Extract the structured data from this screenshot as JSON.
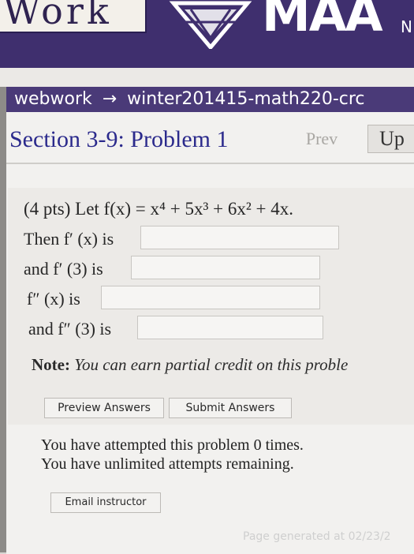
{
  "header": {
    "logo_text": "Work",
    "maa_text": "MAA",
    "maa_extra": "N"
  },
  "breadcrumb": {
    "root": "webwork",
    "arrow": "→",
    "course": "winter201415-math220-crc"
  },
  "section": {
    "title": "Section 3-9: Problem 1",
    "prev_label": "Prev",
    "up_label": "Up"
  },
  "problem": {
    "intro": "(4 pts) Let f(x) = x⁴ + 5x³ + 6x² + 4x.",
    "line1": "Then f′ (x) is",
    "line2": "and f′ (3) is",
    "line3": "f″ (x) is",
    "line4": "and f″ (3) is",
    "answers": [
      "",
      "",
      "",
      ""
    ]
  },
  "note": {
    "label": "Note:",
    "text": "You can earn partial credit on this proble"
  },
  "buttons": {
    "preview": "Preview Answers",
    "submit": "Submit Answers",
    "email": "Email instructor"
  },
  "attempts": {
    "line1": "You have attempted this problem 0 times.",
    "line2": "You have unlimited attempts remaining."
  },
  "footer": {
    "generated": "Page generated at 02/23/2"
  }
}
